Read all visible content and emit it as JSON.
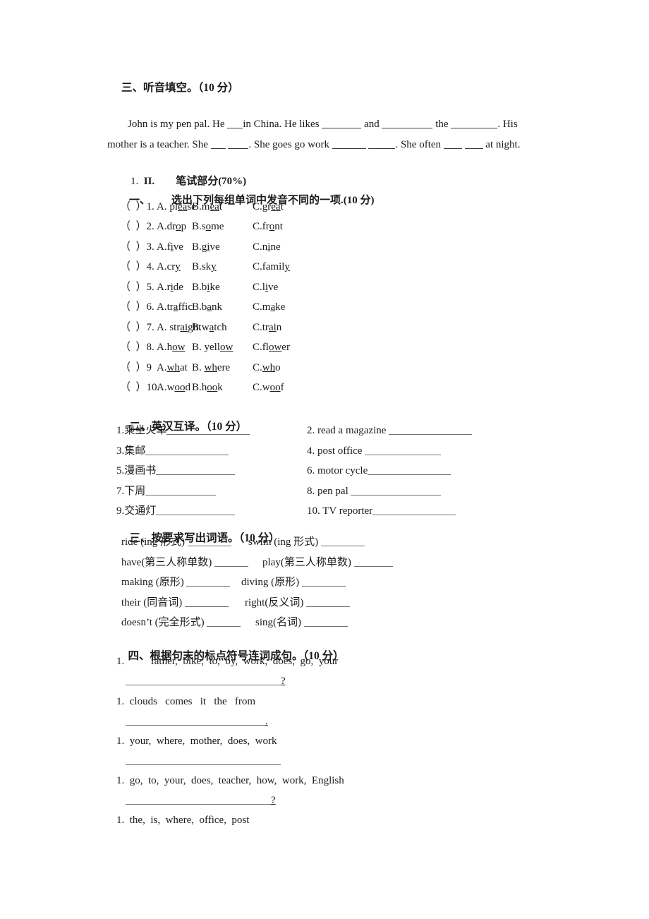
{
  "document": {
    "type": "exam-paper",
    "language": "zh-CN/en"
  },
  "listening_section": {
    "heading": "三、听音填空。（10 分）",
    "passage_line1_part1": "John is my pen pal. He ",
    "passage_line1_part2": "in China. He likes ",
    "passage_line1_part3": " and ",
    "passage_line1_part4": " the ",
    "passage_line1_part5": ". His",
    "passage_line2_part1": "mother is a teacher. She ",
    "passage_line2_part2": " ",
    "passage_line2_part3": ". She goes go work ",
    "passage_line2_part4": " ",
    "passage_line2_part5": ". She often ",
    "passage_line2_part6": " ",
    "passage_line2_part7": " at night."
  },
  "written_part": {
    "list_number": "1.",
    "roman": "II.",
    "title": "笔试部分(70%)"
  },
  "section_one": {
    "number": "一、",
    "title": "选出下列每组单词中发音不同的一项.(10 分)",
    "items": [
      {
        "bracket": "（  ）",
        "num": "1.",
        "options": [
          {
            "label": "A. ",
            "pre": "pl",
            "u": "ea",
            "post": "se"
          },
          {
            "label": "B.",
            "pre": "m",
            "u": "ea",
            "post": "t"
          },
          {
            "label": "C.",
            "pre": "gr",
            "u": "ea",
            "post": "t"
          }
        ]
      },
      {
        "bracket": "（  ）",
        "num": "2. ",
        "options": [
          {
            "label": "A.",
            "pre": "dr",
            "u": "o",
            "post": "p"
          },
          {
            "label": "B.",
            "pre": "s",
            "u": "o",
            "post": "me"
          },
          {
            "label": "C.",
            "pre": "fr",
            "u": "o",
            "post": "nt"
          }
        ]
      },
      {
        "bracket": "（  ）",
        "num": "3. ",
        "options": [
          {
            "label": "A.",
            "pre": "f",
            "u": "i",
            "post": "ve"
          },
          {
            "label": "B.",
            "pre": "g",
            "u": "i",
            "post": "ve"
          },
          {
            "label": "C.",
            "pre": "n",
            "u": "i",
            "post": "ne"
          }
        ]
      },
      {
        "bracket": "（  ）",
        "num": "4. ",
        "options": [
          {
            "label": "A.",
            "pre": "cr",
            "u": "y",
            "post": ""
          },
          {
            "label": "B.",
            "pre": "sk",
            "u": "y",
            "post": ""
          },
          {
            "label": "C.",
            "pre": "famil",
            "u": "y",
            "post": ""
          }
        ]
      },
      {
        "bracket": "（  ）",
        "num": "5. ",
        "options": [
          {
            "label": "A.",
            "pre": "r",
            "u": "i",
            "post": "de"
          },
          {
            "label": "B.",
            "pre": "b",
            "u": "i",
            "post": "ke"
          },
          {
            "label": "C.",
            "pre": "l",
            "u": "i",
            "post": "ve"
          }
        ]
      },
      {
        "bracket": "（  ）",
        "num": "6. ",
        "options": [
          {
            "label": "A.",
            "pre": "tr",
            "u": "a",
            "post": "ffic"
          },
          {
            "label": "B.",
            "pre": "b",
            "u": "a",
            "post": "nk"
          },
          {
            "label": "C.",
            "pre": "m",
            "u": "a",
            "post": "ke"
          }
        ]
      },
      {
        "bracket": "（  ）",
        "num": "7. ",
        "options": [
          {
            "label": "A. ",
            "pre": "str",
            "u": "ai",
            "post": "ght"
          },
          {
            "label": "B.",
            "pre": "w",
            "u": "a",
            "post": "tch"
          },
          {
            "label": "C.",
            "pre": "tr",
            "u": "ai",
            "post": "n"
          }
        ]
      },
      {
        "bracket": "（  ）",
        "num": "8.",
        "options": [
          {
            "label": "A.",
            "pre": "h",
            "u": "ow",
            "post": ""
          },
          {
            "label": "B. ",
            "pre": "yell",
            "u": "ow",
            "post": ""
          },
          {
            "label": "C.",
            "pre": "fl",
            "u": "ow",
            "post": "er"
          }
        ]
      },
      {
        "bracket": "（  ）",
        "num": "9 ",
        "options": [
          {
            "label": "A.",
            "pre": "",
            "u": "wh",
            "post": "at"
          },
          {
            "label": "B. ",
            "pre": "",
            "u": "wh",
            "post": "ere"
          },
          {
            "label": "C.",
            "pre": "",
            "u": "wh",
            "post": "o"
          }
        ]
      },
      {
        "bracket": "（  ）",
        "num": "10. ",
        "options": [
          {
            "label": "A.",
            "pre": "w",
            "u": "oo",
            "post": "d"
          },
          {
            "label": "B.",
            "pre": "h",
            "u": "oo",
            "post": "k"
          },
          {
            "label": "C.",
            "pre": "w",
            "u": "oo",
            "post": "f"
          }
        ]
      }
    ]
  },
  "section_two": {
    "number": "二、",
    "title": "英汉互译。（10 分）",
    "items": [
      {
        "num": "1.",
        "text": "乘坐火车"
      },
      {
        "num": "2. ",
        "text": "read a magazine "
      },
      {
        "num": "3.",
        "text": "集邮"
      },
      {
        "num": "4. ",
        "text": "post office "
      },
      {
        "num": "5.",
        "text": "漫画书"
      },
      {
        "num": "6. ",
        "text": "motor cycle"
      },
      {
        "num": "7.",
        "text": "下周"
      },
      {
        "num": "8. ",
        "text": "pen pal "
      },
      {
        "num": "9.",
        "text": "交通灯"
      },
      {
        "num": "10. ",
        "text": "TV reporter"
      }
    ]
  },
  "section_three": {
    "number": "三、",
    "title": "按要求写出词语。（10 分）",
    "items": [
      {
        "left": "ride (ing 形式) ",
        "right": "swim (ing 形式) "
      },
      {
        "left": "have(第三人称单数) ",
        "right": "play(第三人称单数) "
      },
      {
        "left": "making (原形) ",
        "right": "diving (原形) "
      },
      {
        "left": "their (同音词) ",
        "right": "right(反义词) "
      },
      {
        "left": "doesn’t (完全形式) ",
        "right": "sing(名词) "
      }
    ]
  },
  "section_four": {
    "number": "四、",
    "title": "根据句末的标点符号连词成句。（10 分）",
    "items": [
      {
        "num": "1.",
        "words": "father,  bike,  to,  by,  work,  does,  go,  your",
        "mark": "?"
      },
      {
        "num": "1.",
        "words": "clouds   comes   it   the   from",
        "mark": "."
      },
      {
        "num": "1.",
        "words": "your,  where,  mother,  does,  work",
        "mark": ""
      },
      {
        "num": "1.",
        "words": "go,  to,  your,  does,  teacher,  how,  work,  English",
        "mark": "?"
      },
      {
        "num": "1.",
        "words": "the,  is,  where,  office,  post",
        "mark": ""
      }
    ]
  }
}
